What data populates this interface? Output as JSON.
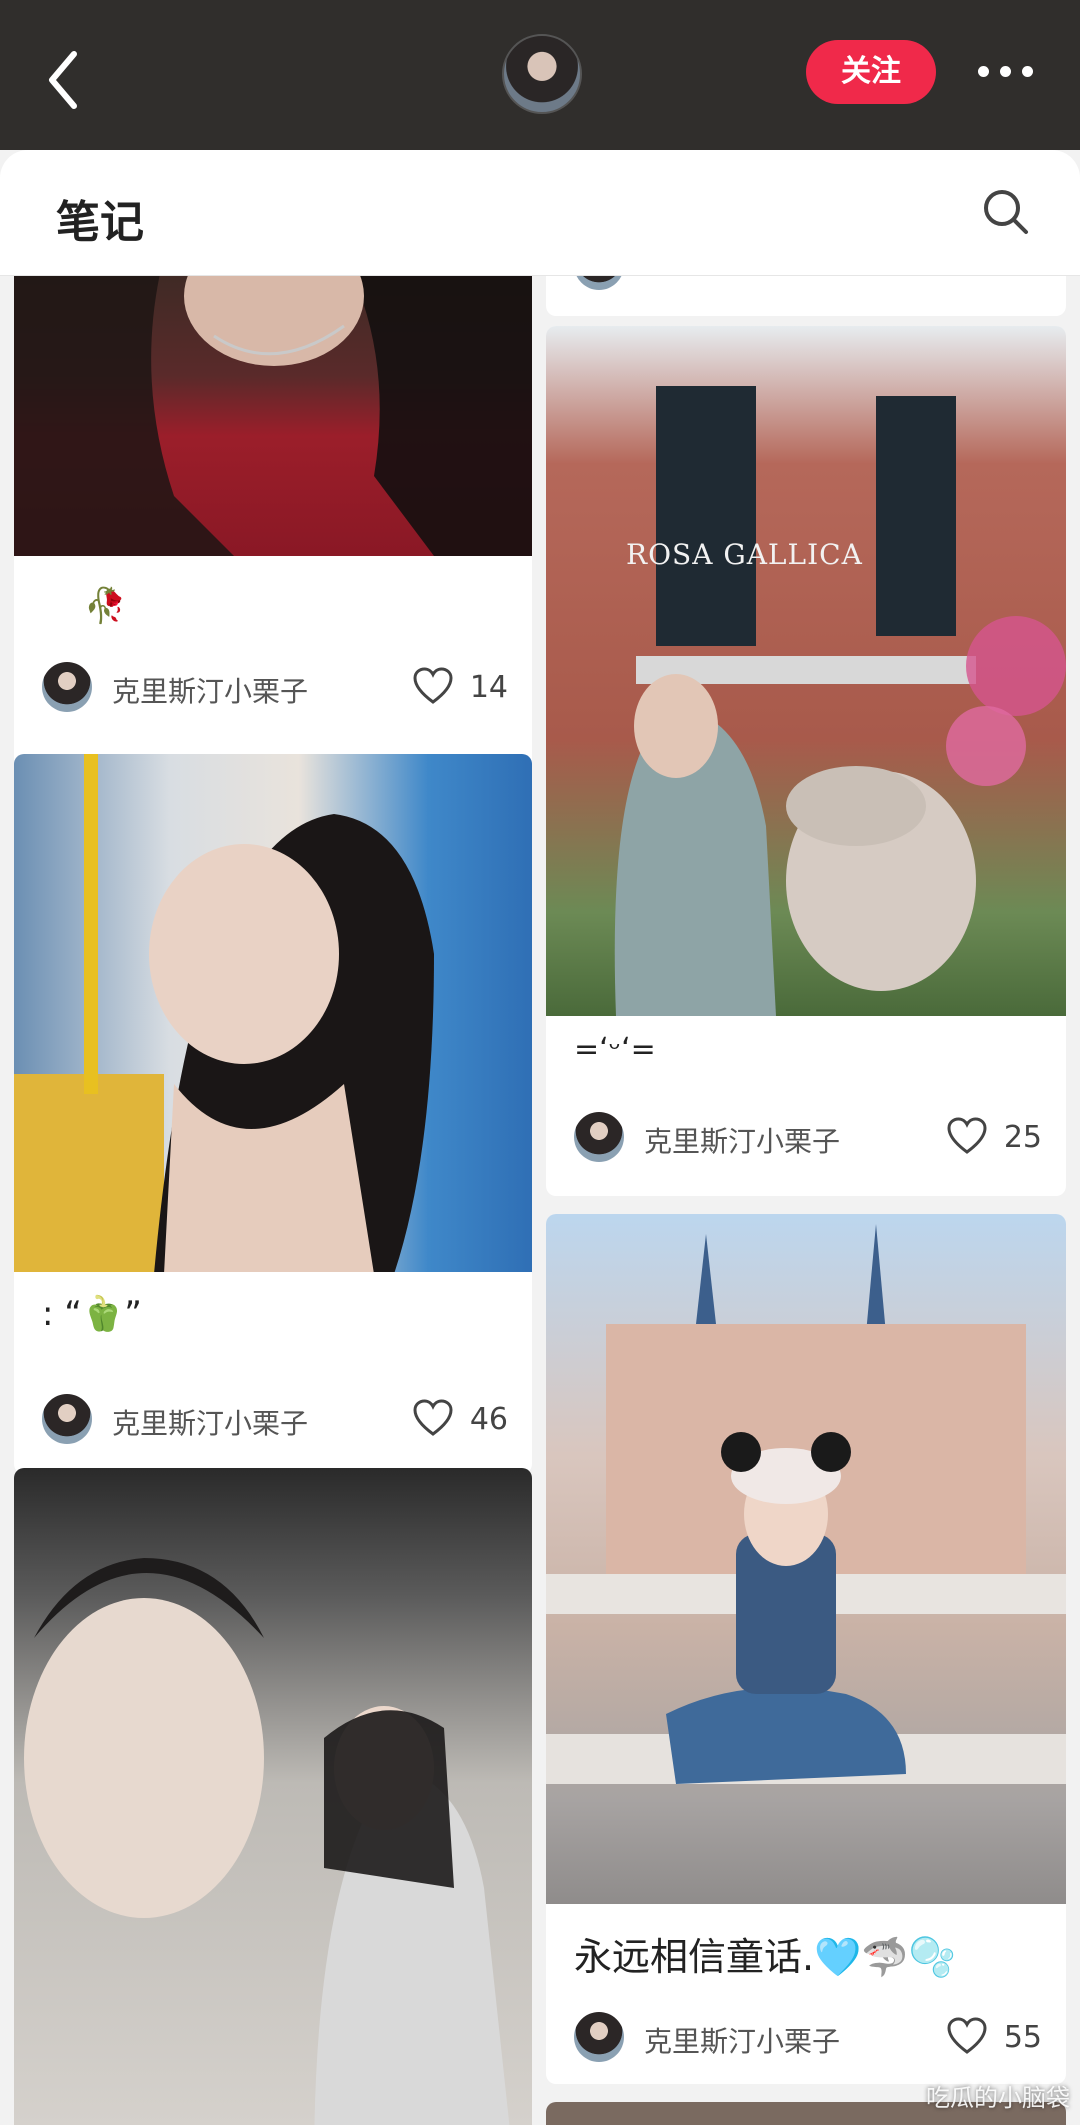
{
  "header": {
    "follow_label": "关注",
    "notes_title": "笔记"
  },
  "cards": [
    {
      "caption": "🥀",
      "author": "克里斯汀小栗子",
      "likes": "14"
    },
    {
      "caption": ":    “🫑”",
      "author": "克里斯汀小栗子",
      "likes": "46"
    },
    {
      "sign_text": "ROSA GALLICA",
      "caption": "=ʻᵕʻ=",
      "author": "克里斯汀小栗子",
      "likes": "25"
    },
    {
      "caption": "永远相信童话.🩵🦈🫧",
      "author": "克里斯汀小栗子",
      "likes": "55"
    }
  ],
  "watermark": "吃瓜的小脑袋",
  "colors": {
    "follow": "#f0294a",
    "topbar": "#302e2c"
  }
}
